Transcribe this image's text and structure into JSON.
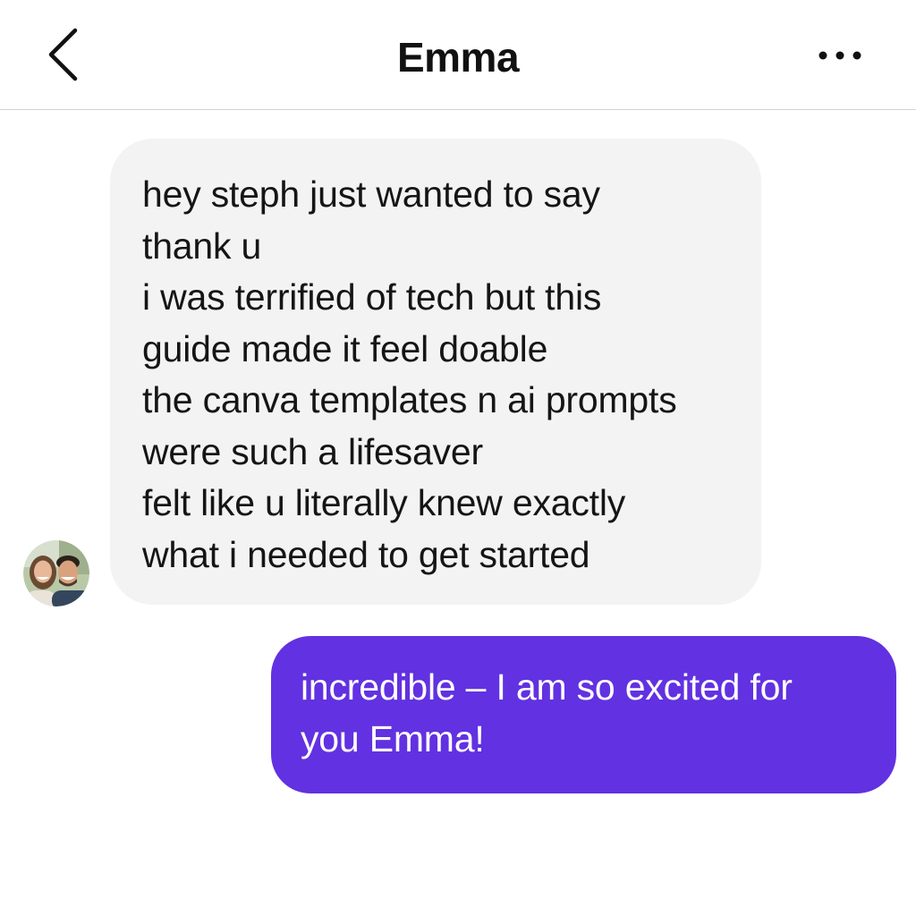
{
  "header": {
    "title": "Emma",
    "back_icon": "chevron-left-icon",
    "more_icon": "more-horizontal-icon"
  },
  "conversation": {
    "contact_avatar": "avatar-photo",
    "messages": [
      {
        "direction": "incoming",
        "lines": [
          "hey steph  just wanted to say",
          "thank u",
          "i was terrified of tech but this",
          "guide made it feel doable",
          "the canva templates n ai prompts",
          "were such a lifesaver",
          "felt like u literally knew exactly",
          "what i needed to get started"
        ]
      },
      {
        "direction": "outgoing",
        "lines": [
          "incredible – I am so excited for",
          "you Emma!"
        ]
      }
    ]
  },
  "colors": {
    "incoming_bubble": "#f3f3f3",
    "outgoing_bubble": "#6231e1",
    "divider": "#d4d4d4"
  }
}
